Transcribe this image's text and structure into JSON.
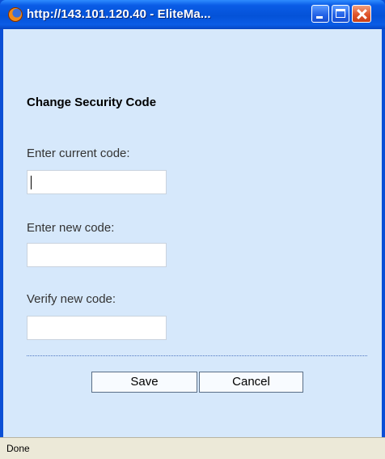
{
  "window": {
    "title": "http://143.101.120.40 - EliteMa...",
    "accent_color": "#0a50d8",
    "content_background": "#d6e8fb"
  },
  "form": {
    "heading": "Change Security Code",
    "current_code_label": "Enter current code:",
    "current_code_value": "",
    "new_code_label": "Enter new code:",
    "new_code_value": "",
    "verify_code_label": "Verify new code:",
    "verify_code_value": ""
  },
  "buttons": {
    "save_label": "Save",
    "cancel_label": "Cancel"
  },
  "status": {
    "text": "Done"
  },
  "icons": {
    "app": "firefox-icon",
    "minimize": "minimize-icon",
    "maximize": "maximize-icon",
    "close": "close-icon"
  }
}
